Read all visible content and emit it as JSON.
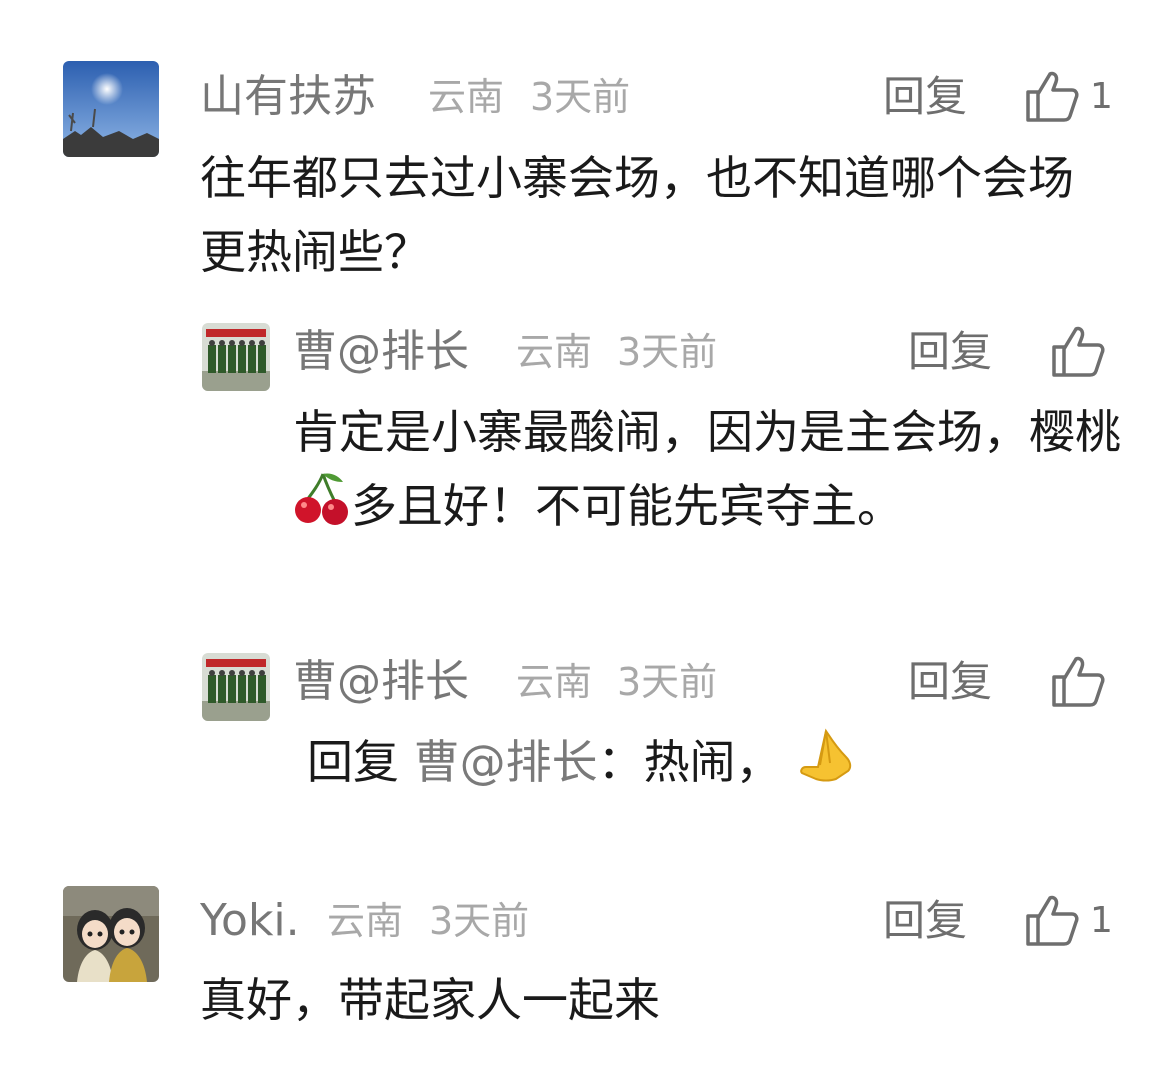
{
  "comments": [
    {
      "author": "山有扶苏",
      "location": "云南",
      "time": "3天前",
      "reply_label": "回复",
      "likes": "1",
      "text": "往年都只去过小寨会场，也不知道哪个会场更热闹些？",
      "avatar_icon": "sky-sun-avatar"
    },
    {
      "author": "曹@排长",
      "location": "云南",
      "time": "3天前",
      "reply_label": "回复",
      "text_part1": "肯定是小寨最酸闹，因为是主会场，樱桃",
      "text_part2": "多且好！不可能先宾夺主。",
      "emoji_icon": "cherries-icon",
      "avatar_icon": "group-photo-avatar"
    },
    {
      "author": "曹@排长",
      "location": "云南",
      "time": "3天前",
      "reply_label": "回复",
      "reply_prefix": "回复",
      "reply_target": "曹@排长",
      "reply_text": "：热闹，",
      "emoji_icon": "praying-hands-icon",
      "avatar_icon": "group-photo-avatar"
    },
    {
      "author": "Yoki.",
      "location": "云南",
      "time": "3天前",
      "reply_label": "回复",
      "likes": "1",
      "text": "真好，带起家人一起来",
      "avatar_icon": "cartoon-couple-avatar"
    }
  ],
  "colors": {
    "name": "#777777",
    "meta": "#a8a8a8",
    "text": "#1a1a1a"
  }
}
